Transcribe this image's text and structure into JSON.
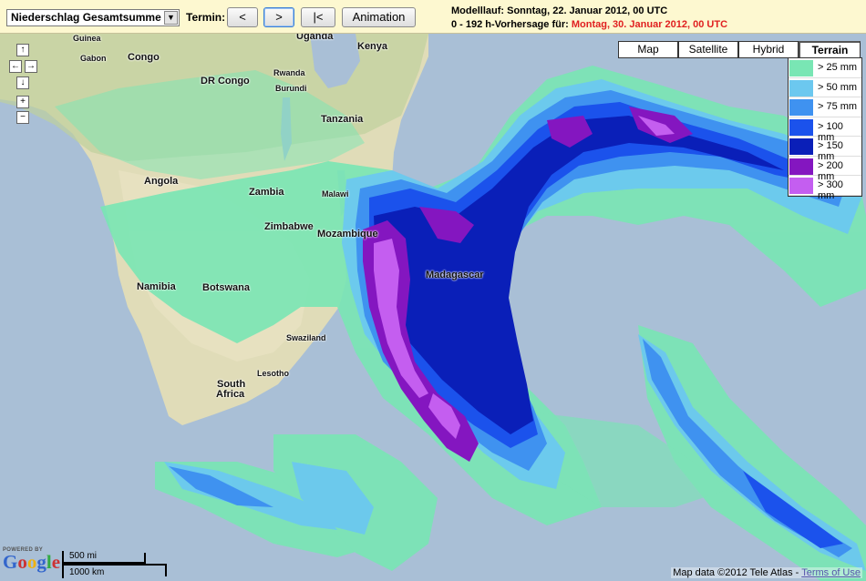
{
  "toolbar": {
    "product_select": "Niederschlag Gesamtsumme",
    "termin_label": "Termin:",
    "prev_label": "<",
    "next_label": ">",
    "first_label": "|<",
    "animation_label": "Animation",
    "modelllauf": "Modelllauf: Sonntag, 22. Januar 2012, 00 UTC",
    "forecast_prefix": "0 - 192 h-Vorhersage für:",
    "forecast_date": "Montag, 30. Januar 2012, 00 UTC",
    "forecast_date_color": "#e02020"
  },
  "map_types": [
    "Map",
    "Satellite",
    "Hybrid",
    "Terrain"
  ],
  "selected_map_type": "Terrain",
  "legend": [
    {
      "label": "> 25 mm",
      "color": "#79e6b4"
    },
    {
      "label": "> 50 mm",
      "color": "#6cc8ef"
    },
    {
      "label": "> 75 mm",
      "color": "#3f92f0"
    },
    {
      "label": "> 100 mm",
      "color": "#1b52ec"
    },
    {
      "label": "> 150 mm",
      "color": "#0a1fb8"
    },
    {
      "label": "> 200 mm",
      "color": "#8416c0"
    },
    {
      "label": "> 300 mm",
      "color": "#c45ef0"
    }
  ],
  "nav": {
    "up": "↑",
    "left": "←",
    "right": "→",
    "down": "↓",
    "zoom_in": "+",
    "zoom_out": "−"
  },
  "places": {
    "guinea": "Guinea",
    "gabon": "Gabon",
    "congo": "Congo",
    "dr_congo": "DR Congo",
    "uganda": "Uganda",
    "kenya": "Kenya",
    "rwanda": "Rwanda",
    "burundi": "Burundi",
    "tanzania": "Tanzania",
    "angola": "Angola",
    "zambia": "Zambia",
    "malawi": "Malawi",
    "mozambique": "Mozambique",
    "zimbabwe": "Zimbabwe",
    "namibia": "Namibia",
    "botswana": "Botswana",
    "madagascar": "Madagascar",
    "swaziland": "Swaziland",
    "lesotho": "Lesotho",
    "south_africa_1": "South",
    "south_africa_2": "Africa"
  },
  "branding": {
    "powered_by": "POWERED BY",
    "google": "Google"
  },
  "scale": {
    "miles": "500 mi",
    "km": "1000 km"
  },
  "copyright": {
    "text": "Map data ©2012 Tele Atlas - ",
    "terms": "Terms of Use"
  }
}
